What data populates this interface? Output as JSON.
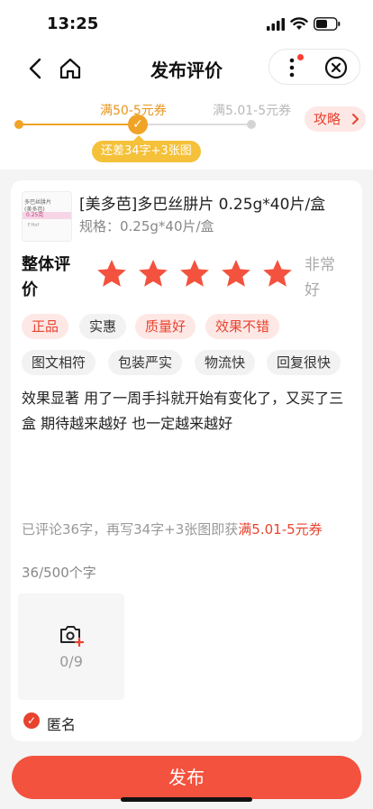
{
  "status_bar": {
    "time": "13:25"
  },
  "nav": {
    "title": "发布评价",
    "icons": [
      "back-icon",
      "home-icon",
      "more-icon",
      "close-icon"
    ]
  },
  "progress": {
    "stage1_label": "满50-5元券",
    "stage2_label": "满5.01-5元券",
    "remaining_pill": "还差34字+3张图",
    "strategy_button": "攻略"
  },
  "product": {
    "title": "[美多芭]多巴丝肼片 0.25g*40片/盒",
    "spec": "规格：0.25g*40片/盒",
    "thumb_lines": [
      "多巴丝肼片",
      "(美多芭)",
      "0.25克",
      "F.Hof"
    ]
  },
  "rating": {
    "label": "整体评价",
    "stars": 5,
    "max_stars": 5,
    "text": "非常好"
  },
  "tags": [
    {
      "label": "正品",
      "selected": true
    },
    {
      "label": "实惠",
      "selected": false
    },
    {
      "label": "质量好",
      "selected": true
    },
    {
      "label": "效果不错",
      "selected": true
    },
    {
      "label": "图文相符",
      "selected": false
    },
    {
      "label": "包装严实",
      "selected": false
    },
    {
      "label": "物流快",
      "selected": false
    },
    {
      "label": "回复很快",
      "selected": false
    }
  ],
  "review": {
    "text": "效果显著 用了一周手抖就开始有变化了，又买了三盒 期待越来越好 也一定越来越好",
    "hint_prefix": "已评论36字，再写34字+3张图即获",
    "hint_highlight": "满5.01-5元券",
    "char_count": "36/500个字"
  },
  "upload": {
    "count": "0/9"
  },
  "anonymous": {
    "label": "匿名",
    "checked": true
  },
  "publish_button": "发布",
  "colors": {
    "accent": "#f3523e",
    "progress": "#f0a326",
    "pill": "#f5c13a"
  }
}
